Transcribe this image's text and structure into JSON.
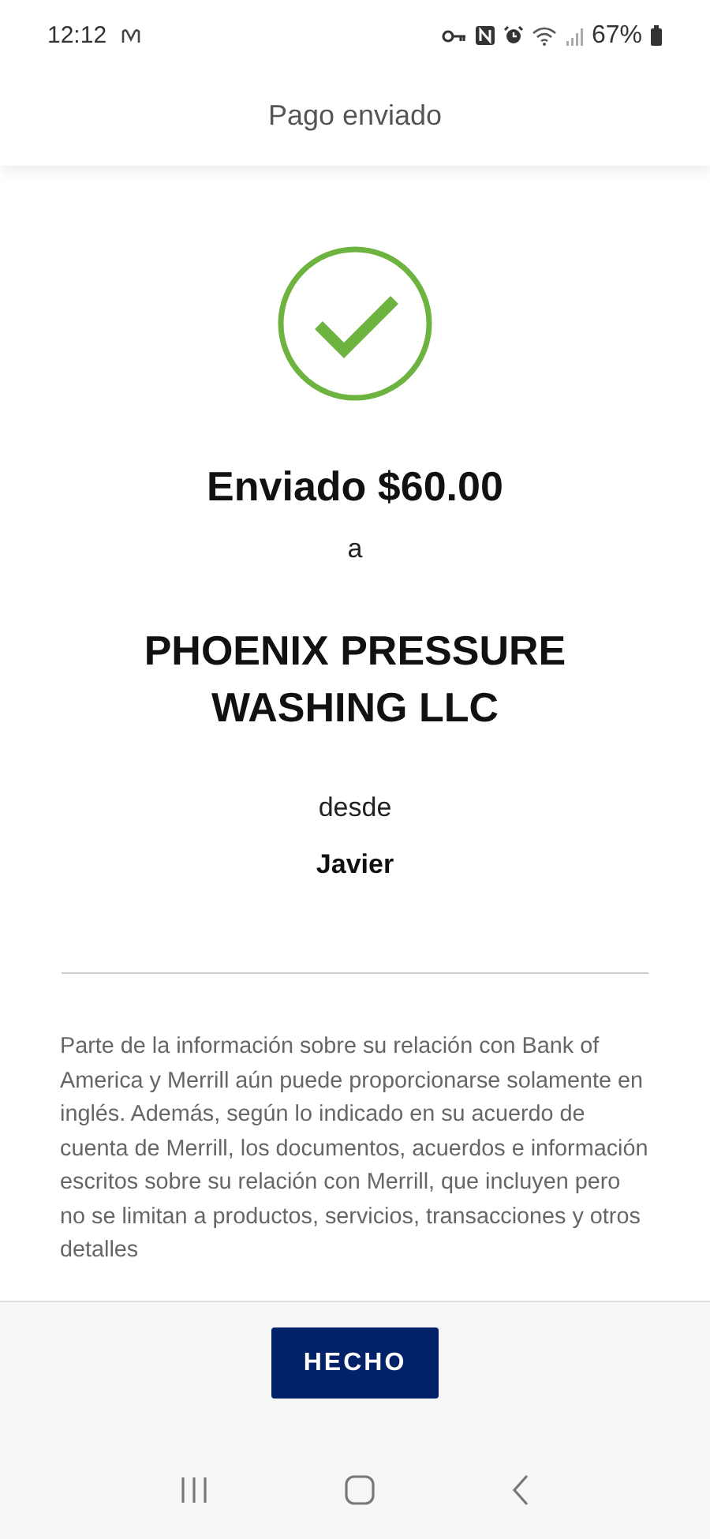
{
  "status_bar": {
    "time": "12:12",
    "battery": "67%"
  },
  "header": {
    "title": "Pago enviado"
  },
  "confirmation": {
    "amount_line": "Enviado $60.00",
    "to_word": "a",
    "recipient": "PHOENIX PRESSURE WASHING LLC",
    "from_word": "desde",
    "sender": "Javier"
  },
  "disclaimer": "Parte de la información sobre su relación con Bank of America y Merrill aún puede proporcionarse solamente en inglés. Además, según lo indicado en su acuerdo de cuenta de Merrill, los documentos, acuerdos e información escritos sobre su relación con Merrill, que incluyen pero no se limitan a productos, servicios, transacciones y otros detalles",
  "footer": {
    "button": "HECHO"
  }
}
